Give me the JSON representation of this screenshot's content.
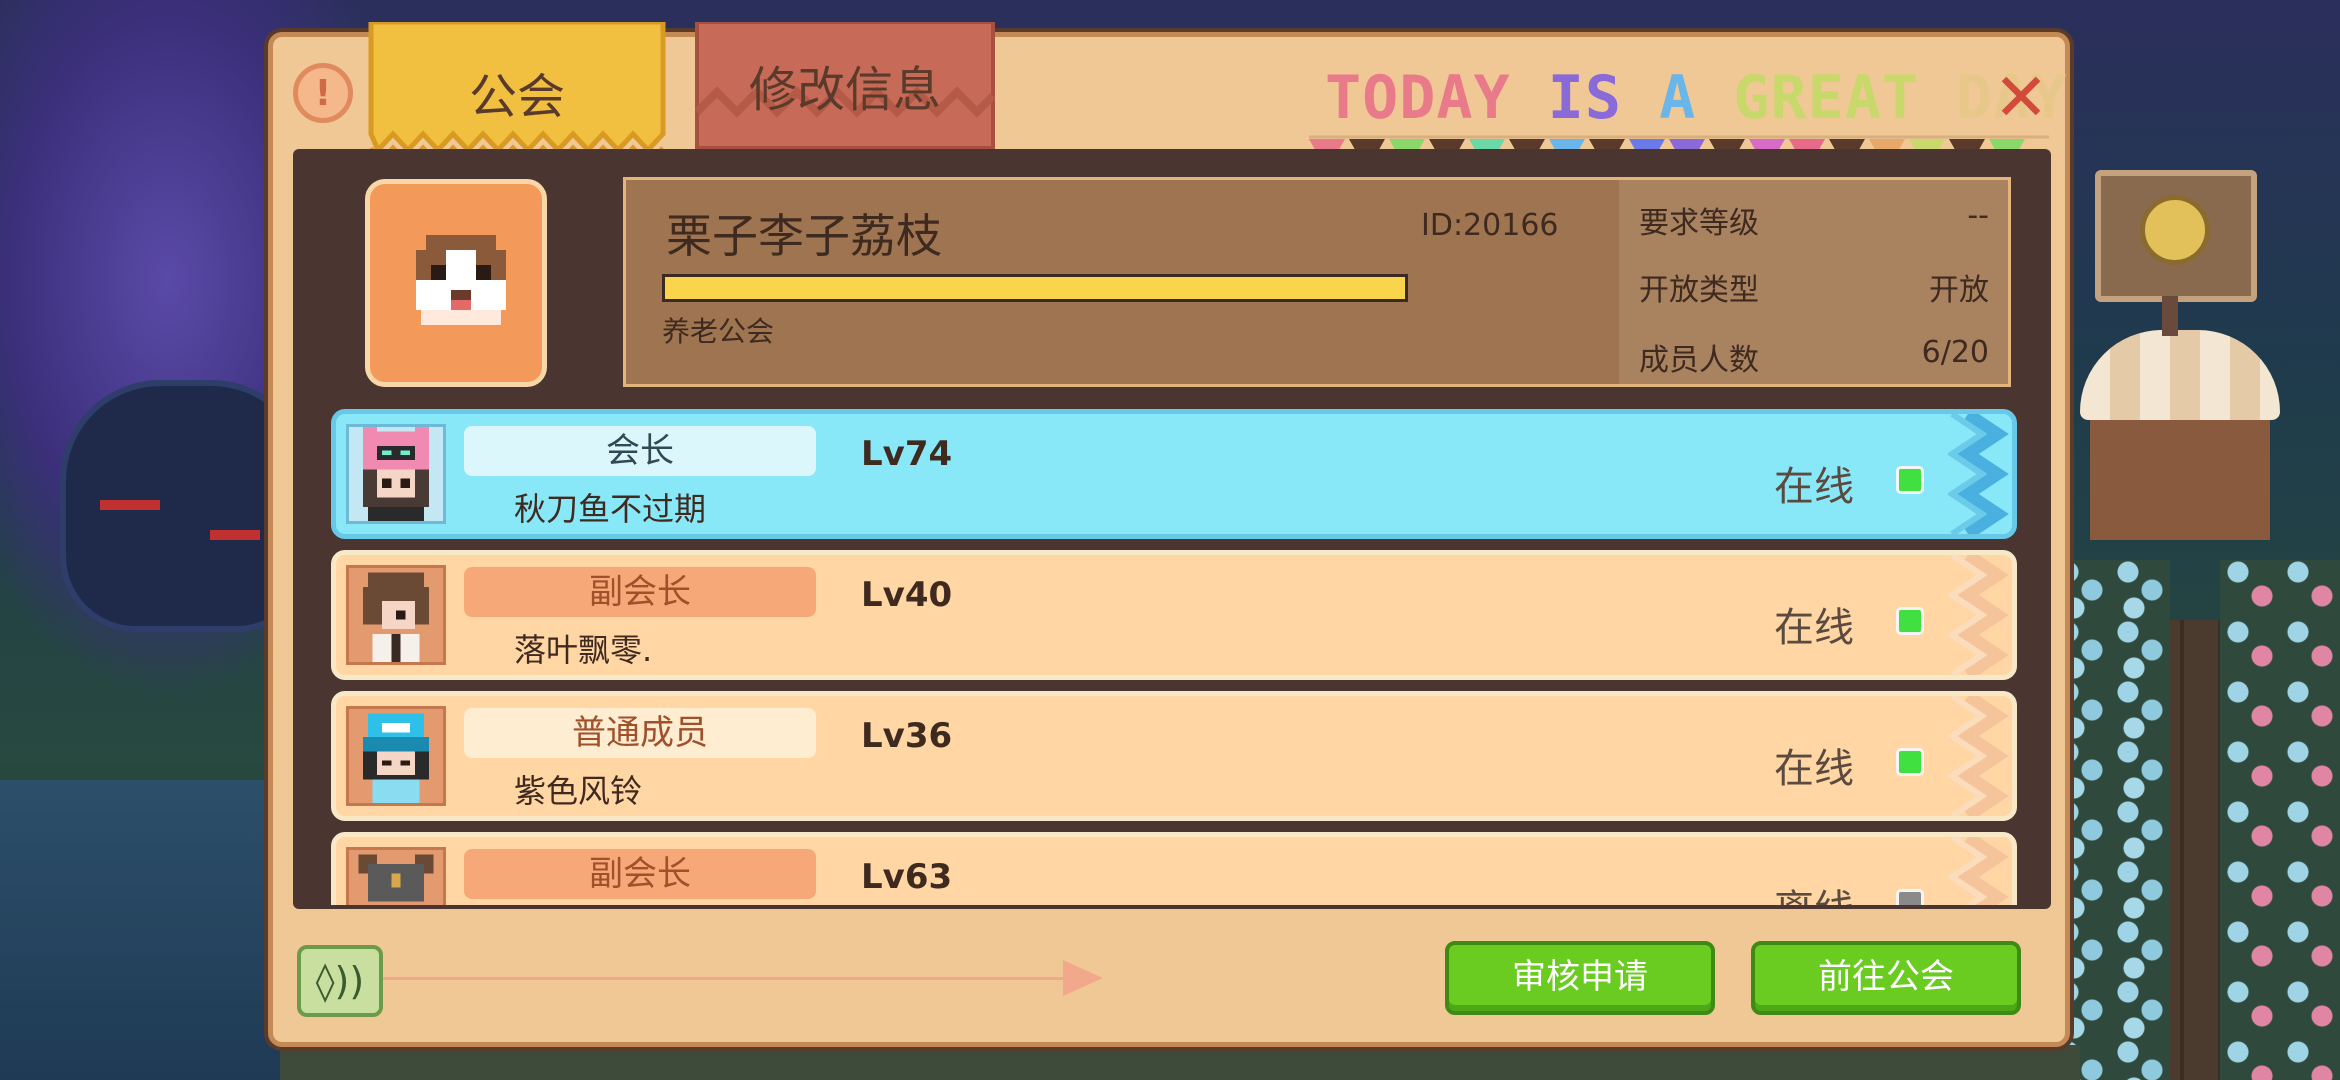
{
  "tabs": {
    "guild": "公会",
    "edit_info": "修改信息"
  },
  "banner": {
    "words": [
      {
        "text": "TODAY",
        "color": "#e87a8a"
      },
      {
        "text": " ",
        "color": "#e87a8a"
      },
      {
        "text": "IS",
        "color": "#8a6ad8"
      },
      {
        "text": " ",
        "color": "#8a6ad8"
      },
      {
        "text": "A",
        "color": "#6ab6e8"
      },
      {
        "text": " ",
        "color": "#6ab6e8"
      },
      {
        "text": "GREAT",
        "color": "#c8d86a"
      },
      {
        "text": " ",
        "color": "#c8d86a"
      },
      {
        "text": "DAY",
        "color": "#e8c88a"
      }
    ]
  },
  "icons": {
    "help": "!",
    "close": "✕",
    "sound": "◊))"
  },
  "guild": {
    "name": "栗子李子荔枝",
    "id": "ID:20166",
    "tag": "养老公会",
    "stats": [
      {
        "label": "要求等级",
        "value": "--"
      },
      {
        "label": "开放类型",
        "value": "开放"
      },
      {
        "label": "成员人数",
        "value": "6/20"
      }
    ]
  },
  "members": [
    {
      "role": "会长",
      "role_type": "leader",
      "name": "秋刀鱼不过期",
      "level": "Lv74",
      "status": "在线",
      "online": true
    },
    {
      "role": "副会长",
      "role_type": "vice",
      "name": "落叶飘零.",
      "level": "Lv40",
      "status": "在线",
      "online": true
    },
    {
      "role": "普通成员",
      "role_type": "member",
      "name": "紫色风铃",
      "level": "Lv36",
      "status": "在线",
      "online": true
    },
    {
      "role": "副会长",
      "role_type": "vice",
      "name": "",
      "level": "Lv63",
      "status": "离线",
      "online": false
    }
  ],
  "buttons": {
    "review": "审核申请",
    "goto": "前往公会"
  }
}
